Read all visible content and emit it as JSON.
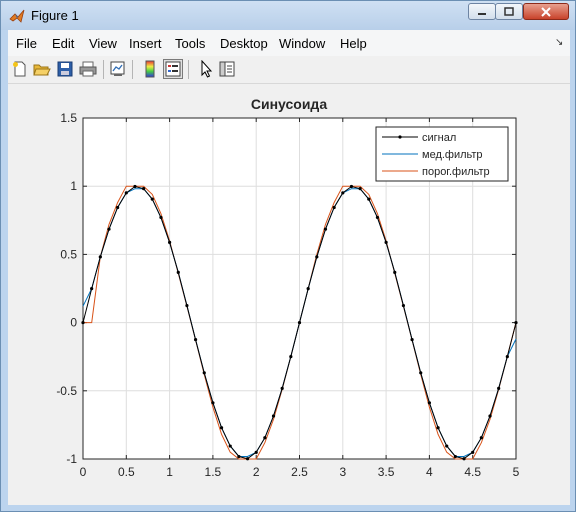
{
  "window": {
    "title": "Figure 1"
  },
  "menu": [
    {
      "label": "File"
    },
    {
      "label": "Edit"
    },
    {
      "label": "View"
    },
    {
      "label": "Insert"
    },
    {
      "label": "Tools"
    },
    {
      "label": "Desktop"
    },
    {
      "label": "Window"
    },
    {
      "label": "Help"
    }
  ],
  "toolbar": [
    {
      "icon": "new-figure-icon"
    },
    {
      "icon": "open-file-icon"
    },
    {
      "icon": "save-icon"
    },
    {
      "icon": "print-icon"
    },
    {
      "icon": "link-plot-icon"
    },
    {
      "icon": "insert-colorbar-icon"
    },
    {
      "icon": "insert-legend-icon",
      "active": true
    },
    {
      "icon": "edit-plot-icon"
    },
    {
      "icon": "property-inspector-icon"
    }
  ],
  "chart_data": {
    "type": "line",
    "title": "Синусоида",
    "xlabel": "",
    "ylabel": "",
    "xlim": [
      0,
      5
    ],
    "ylim": [
      -1,
      1.5
    ],
    "xticks": [
      "0",
      "0.5",
      "1",
      "1.5",
      "2",
      "2.5",
      "3",
      "3.5",
      "4",
      "4.5",
      "5"
    ],
    "yticks": [
      "-1",
      "-0.5",
      "0",
      "0.5",
      "1",
      "1.5"
    ],
    "grid": true,
    "legend_position": "top-right",
    "series": [
      {
        "name": "сигнал",
        "color": "#000000",
        "marker": "dot",
        "x": [
          0,
          0.1,
          0.2,
          0.3,
          0.4,
          0.5,
          0.6,
          0.7,
          0.8,
          0.9,
          1.0,
          1.1,
          1.2,
          1.3,
          1.4,
          1.5,
          1.6,
          1.7,
          1.8,
          1.9,
          2.0,
          2.1,
          2.2,
          2.3,
          2.4,
          2.5,
          2.6,
          2.7,
          2.8,
          2.9,
          3.0,
          3.1,
          3.2,
          3.3,
          3.4,
          3.5,
          3.6,
          3.7,
          3.8,
          3.9,
          4.0,
          4.1,
          4.2,
          4.3,
          4.4,
          4.5,
          4.6,
          4.7,
          4.8,
          4.9,
          5.0
        ],
        "y": [
          0,
          0.249,
          0.482,
          0.685,
          0.844,
          0.951,
          0.998,
          0.982,
          0.905,
          0.771,
          0.588,
          0.368,
          0.125,
          -0.125,
          -0.368,
          -0.588,
          -0.771,
          -0.905,
          -0.982,
          -0.998,
          -0.951,
          -0.844,
          -0.685,
          -0.482,
          -0.249,
          0,
          0.249,
          0.482,
          0.685,
          0.844,
          0.951,
          0.998,
          0.982,
          0.905,
          0.771,
          0.588,
          0.368,
          0.125,
          -0.125,
          -0.368,
          -0.588,
          -0.771,
          -0.905,
          -0.982,
          -0.998,
          -0.951,
          -0.844,
          -0.685,
          -0.482,
          -0.249,
          0
        ]
      },
      {
        "name": "мед.фильтр",
        "color": "#0072bd",
        "x": [
          0,
          0.1,
          0.2,
          0.3,
          0.4,
          0.5,
          0.6,
          0.7,
          0.8,
          0.9,
          1.0,
          1.1,
          1.2,
          1.3,
          1.4,
          1.5,
          1.6,
          1.7,
          1.8,
          1.9,
          2.0,
          2.1,
          2.2,
          2.3,
          2.4,
          2.5,
          2.6,
          2.7,
          2.8,
          2.9,
          3.0,
          3.1,
          3.2,
          3.3,
          3.4,
          3.5,
          3.6,
          3.7,
          3.8,
          3.9,
          4.0,
          4.1,
          4.2,
          4.3,
          4.4,
          4.5,
          4.6,
          4.7,
          4.8,
          4.9,
          5.0
        ],
        "y": [
          0.12,
          0.249,
          0.482,
          0.685,
          0.844,
          0.951,
          0.982,
          0.982,
          0.905,
          0.771,
          0.588,
          0.368,
          0.125,
          -0.125,
          -0.368,
          -0.588,
          -0.771,
          -0.905,
          -0.982,
          -0.982,
          -0.951,
          -0.844,
          -0.685,
          -0.482,
          -0.249,
          0,
          0.249,
          0.482,
          0.685,
          0.844,
          0.951,
          0.982,
          0.982,
          0.905,
          0.771,
          0.588,
          0.368,
          0.125,
          -0.125,
          -0.368,
          -0.588,
          -0.771,
          -0.905,
          -0.982,
          -0.982,
          -0.951,
          -0.844,
          -0.685,
          -0.482,
          -0.249,
          -0.12
        ]
      },
      {
        "name": "порог.фильтр",
        "color": "#d95319",
        "x": [
          0,
          0.1,
          0.2,
          0.3,
          0.4,
          0.5,
          0.6,
          0.7,
          0.8,
          0.9,
          1.0,
          1.1,
          1.2,
          1.3,
          1.4,
          1.5,
          1.6,
          1.7,
          1.8,
          1.9,
          2.0,
          2.1,
          2.2,
          2.3,
          2.4,
          2.5,
          2.6,
          2.7,
          2.8,
          2.9,
          3.0,
          3.1,
          3.2,
          3.3,
          3.4,
          3.5,
          3.6,
          3.7,
          3.8,
          3.9,
          4.0,
          4.1,
          4.2,
          4.3,
          4.4,
          4.5,
          4.6,
          4.7,
          4.8,
          4.9,
          5.0
        ],
        "y": [
          0,
          0,
          0.482,
          0.72,
          0.88,
          1,
          1,
          1,
          0.94,
          0.8,
          0.6,
          0.36,
          0.12,
          -0.13,
          -0.38,
          -0.62,
          -0.82,
          -0.95,
          -1,
          -1,
          -1,
          -0.88,
          -0.71,
          -0.49,
          -0.25,
          0,
          0.25,
          0.5,
          0.72,
          0.88,
          1,
          1,
          1,
          0.94,
          0.8,
          0.6,
          0.36,
          0.12,
          -0.13,
          -0.38,
          -0.62,
          -0.82,
          -0.95,
          -1,
          -1,
          -1,
          -0.88,
          -0.71,
          -0.49,
          -0.25,
          0
        ]
      }
    ]
  }
}
